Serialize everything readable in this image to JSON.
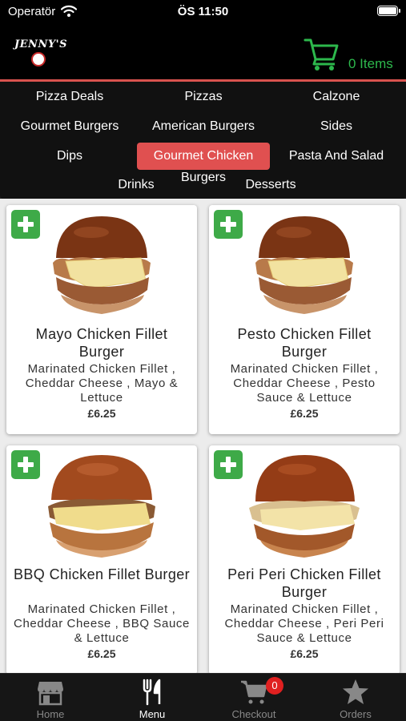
{
  "status_bar": {
    "carrier": "Operatör",
    "time": "ÖS 11:50"
  },
  "header": {
    "logo_text": "JENNY'S",
    "cart_count_label": "0 Items",
    "accent_color": "#2db84c"
  },
  "categories": [
    {
      "label": "Pizza Deals",
      "active": false
    },
    {
      "label": "Pizzas",
      "active": false
    },
    {
      "label": "Calzone",
      "active": false
    },
    {
      "label": "Gourmet Burgers",
      "active": false
    },
    {
      "label": "American Burgers",
      "active": false
    },
    {
      "label": "Sides",
      "active": false
    },
    {
      "label": "Dips",
      "active": false
    },
    {
      "label": "Gourmet Chicken",
      "active": true
    },
    {
      "label": "Pasta And Salad",
      "active": false
    },
    {
      "label": "Burgers",
      "active": false
    },
    {
      "label": "Drinks",
      "active": false
    },
    {
      "label": "Desserts",
      "active": false
    }
  ],
  "active_category_color": "#e05050",
  "products": [
    {
      "title": "Mayo Chicken Fillet Burger",
      "description": "Marinated Chicken Fillet , Cheddar Cheese , Mayo & Lettuce",
      "price": "£6.25"
    },
    {
      "title": "Pesto Chicken Fillet Burger",
      "description": "Marinated Chicken Fillet , Cheddar Cheese , Pesto Sauce & Lettuce",
      "price": "£6.25"
    },
    {
      "title": "BBQ Chicken Fillet Burger",
      "description": "Marinated Chicken Fillet , Cheddar Cheese , BBQ Sauce & Lettuce",
      "price": "£6.25"
    },
    {
      "title": "Peri Peri Chicken Fillet Burger",
      "description": "Marinated Chicken Fillet , Cheddar Cheese , Peri Peri Sauce & Lettuce",
      "price": "£6.25"
    }
  ],
  "tabs": [
    {
      "label": "Home",
      "icon": "store-icon",
      "active": false
    },
    {
      "label": "Menu",
      "icon": "cutlery-icon",
      "active": true
    },
    {
      "label": "Checkout",
      "icon": "cart-icon",
      "active": false,
      "badge": "0"
    },
    {
      "label": "Orders",
      "icon": "star-icon",
      "active": false
    }
  ]
}
